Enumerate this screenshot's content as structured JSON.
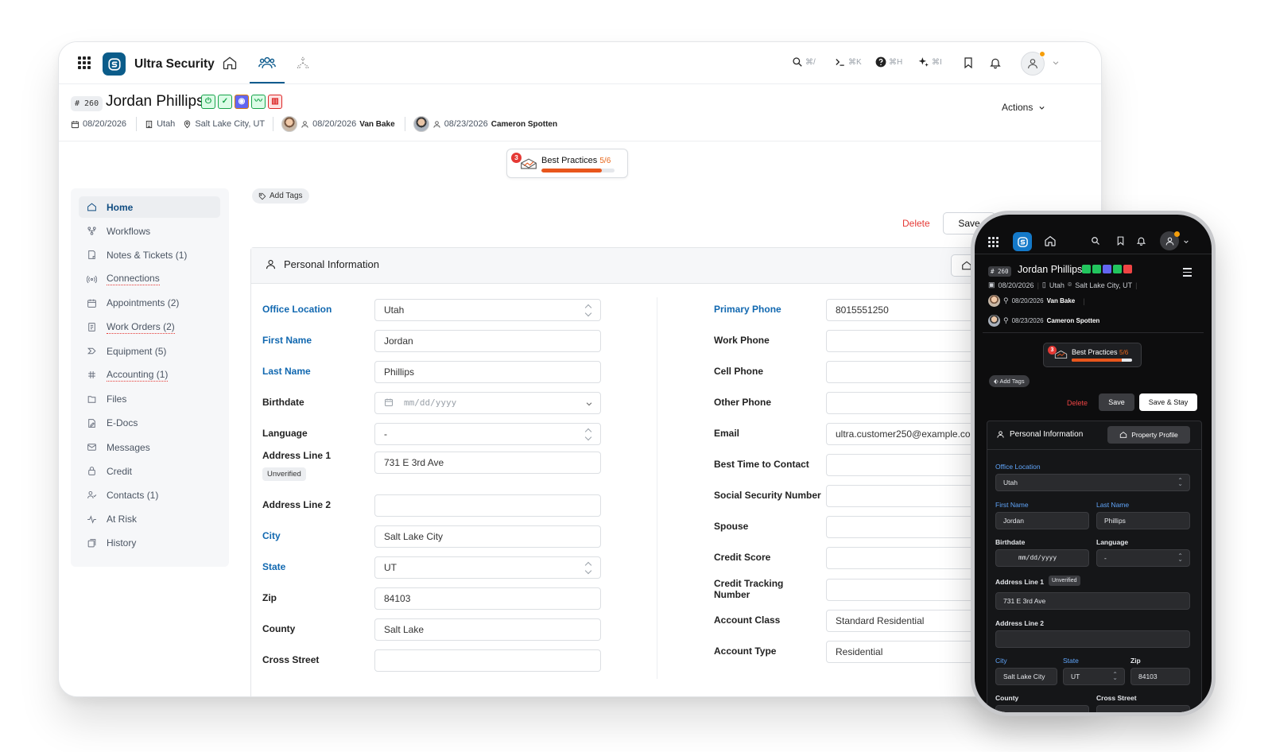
{
  "app": {
    "brand": "Ultra Security"
  },
  "toolbar": {
    "search_shortcut": "⌘/",
    "terminal_shortcut": "⌘K",
    "help_shortcut": "⌘H",
    "ai_shortcut": "⌘I"
  },
  "record": {
    "id": "# 260",
    "name": "Jordan Phillips",
    "date": "08/20/2026",
    "state": "Utah",
    "location": "Salt Lake City, UT",
    "rep1_date": "08/20/2026",
    "rep1_name": "Van Bake",
    "rep2_date": "08/23/2026",
    "rep2_name": "Cameron Spotten",
    "actions_label": "Actions"
  },
  "best_practices": {
    "label": "Best Practices",
    "fraction": "5/6",
    "badge": "3",
    "progress": 0.83
  },
  "sidebar": {
    "items": [
      {
        "label": "Home"
      },
      {
        "label": "Workflows"
      },
      {
        "label": "Notes & Tickets (1)"
      },
      {
        "label": "Connections"
      },
      {
        "label": "Appointments (2)"
      },
      {
        "label": "Work Orders (2)"
      },
      {
        "label": "Equipment (5)"
      },
      {
        "label": "Accounting (1)"
      },
      {
        "label": "Files"
      },
      {
        "label": "E-Docs"
      },
      {
        "label": "Messages"
      },
      {
        "label": "Credit"
      },
      {
        "label": "Contacts (1)"
      },
      {
        "label": "At Risk"
      },
      {
        "label": "History"
      }
    ]
  },
  "tags": {
    "add_label": "Add Tags"
  },
  "buttons": {
    "delete": "Delete",
    "save": "Save",
    "save_stay": "Save & Stay"
  },
  "panel": {
    "title": "Personal Information",
    "property_profile": "Property Profile"
  },
  "form": {
    "office_location": {
      "label": "Office Location",
      "value": "Utah"
    },
    "first_name": {
      "label": "First Name",
      "value": "Jordan"
    },
    "last_name": {
      "label": "Last Name",
      "value": "Phillips"
    },
    "birthdate": {
      "label": "Birthdate",
      "placeholder": "mm/dd/yyyy"
    },
    "language": {
      "label": "Language",
      "value": "-"
    },
    "address1": {
      "label": "Address Line 1",
      "value": "731 E 3rd Ave",
      "badge": "Unverified"
    },
    "address2": {
      "label": "Address Line 2",
      "value": ""
    },
    "city": {
      "label": "City",
      "value": "Salt Lake City"
    },
    "state": {
      "label": "State",
      "value": "UT"
    },
    "zip": {
      "label": "Zip",
      "value": "84103"
    },
    "county": {
      "label": "County",
      "value": "Salt Lake"
    },
    "cross_street": {
      "label": "Cross Street",
      "value": ""
    },
    "primary_phone": {
      "label": "Primary Phone",
      "value": "8015551250"
    },
    "work_phone": {
      "label": "Work Phone",
      "value": ""
    },
    "cell_phone": {
      "label": "Cell Phone",
      "value": ""
    },
    "other_phone": {
      "label": "Other Phone",
      "value": ""
    },
    "email": {
      "label": "Email",
      "value": "ultra.customer250@example.com"
    },
    "best_time": {
      "label": "Best Time to Contact",
      "value": ""
    },
    "ssn": {
      "label": "Social Security Number",
      "value": ""
    },
    "spouse": {
      "label": "Spouse",
      "value": ""
    },
    "credit_score": {
      "label": "Credit Score",
      "value": ""
    },
    "credit_tracking": {
      "label": "Credit Tracking Number",
      "value": ""
    },
    "account_class": {
      "label": "Account Class",
      "value": "Standard Residential"
    },
    "account_type": {
      "label": "Account Type",
      "value": "Residential"
    }
  }
}
